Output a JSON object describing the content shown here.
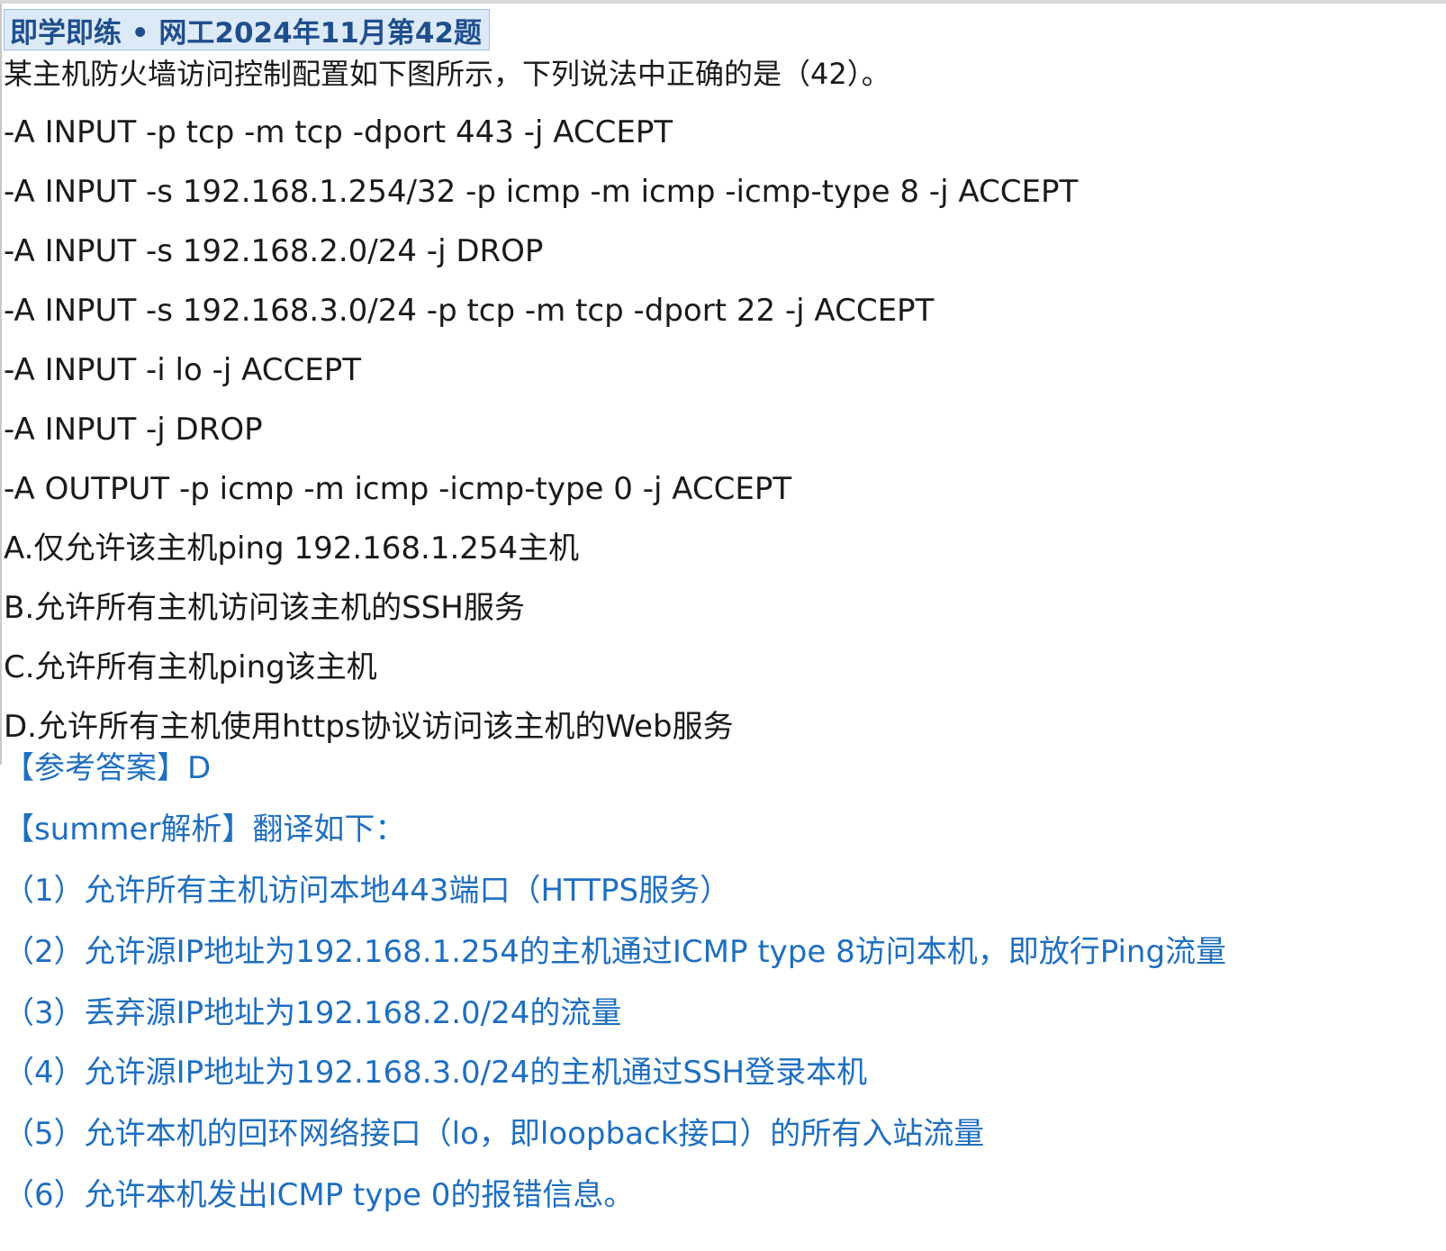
{
  "title": "即学即练 • 网工2024年11月第42题",
  "question": "某主机防火墙访问控制配置如下图所示，下列说法中正确的是（42）。",
  "rules": [
    "-A INPUT -p tcp -m tcp -dport 443 -j ACCEPT",
    "-A INPUT -s 192.168.1.254/32 -p icmp -m icmp -icmp-type 8 -j ACCEPT",
    "-A INPUT -s 192.168.2.0/24 -j DROP",
    "-A INPUT -s 192.168.3.0/24 -p tcp -m tcp -dport 22 -j ACCEPT",
    "-A INPUT -i lo -j ACCEPT",
    "-A INPUT -j DROP",
    "-A OUTPUT -p icmp -m icmp -icmp-type 0 -j ACCEPT"
  ],
  "options": [
    "A.仅允许该主机ping 192.168.1.254主机",
    "B.允许所有主机访问该主机的SSH服务",
    "C.允许所有主机ping该主机",
    "D.允许所有主机使用https协议访问该主机的Web服务"
  ],
  "answer": "【参考答案】D",
  "analysis_header": "【summer解析】翻译如下：",
  "analysis": [
    "（1）允许所有主机访问本地443端口（HTTPS服务）",
    "（2）允许源IP地址为192.168.1.254的主机通过ICMP type 8访问本机，即放行Ping流量",
    "（3）丢弃源IP地址为192.168.2.0/24的流量",
    "（4）允许源IP地址为192.168.3.0/24的主机通过SSH登录本机",
    "（5）允许本机的回环网络接口（lo，即loopback接口）的所有入站流量",
    "（6）允许本机发出ICMP type 0的报错信息。"
  ],
  "colors": {
    "title_bg": "#dce9f7",
    "title_text": "#1f4e8c",
    "body_text": "#1a1a1a",
    "answer_text": "#1f6fbf"
  }
}
